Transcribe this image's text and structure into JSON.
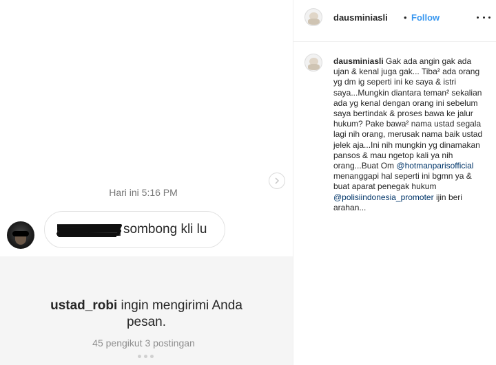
{
  "dm": {
    "timestamp": "Hari ini 5:16 PM",
    "message_text": "sombong kli lu",
    "notice_username": "ustad_robi",
    "notice_text": "ingin mengirimi Anda pesan.",
    "notice_stats": "45 pengikut 3 postingan",
    "next_icon": "chevron-right-icon"
  },
  "post": {
    "header": {
      "username": "dausminiasli",
      "separator": "•",
      "follow_label": "Follow",
      "more_icon": "more-options-icon"
    },
    "caption": {
      "username": "dausminiasli",
      "text_1": "Gak ada angin gak ada ujan & kenal juga gak... Tiba² ada orang yg dm ig seperti ini ke saya & istri saya...Mungkin diantara teman² sekalian ada yg kenal dengan orang ini sebelum saya bertindak & proses bawa ke jalur hukum? Pake bawa² nama ustad segala lagi nih orang, merusak nama baik ustad jelek aja...Ini nih mungkin yg dinamakan pansos & mau ngetop kali ya nih orang...Buat Om",
      "mention_1": "@hotmanparisofficial",
      "text_2": "menanggapi hal seperti ini bgmn ya & buat aparat penegak hukum",
      "mention_2": "@polisiindonesia_promoter",
      "text_3": "ijin beri arahan..."
    }
  },
  "colors": {
    "follow": "#3897f0",
    "mention": "#003569",
    "muted": "#8e8e8e"
  }
}
